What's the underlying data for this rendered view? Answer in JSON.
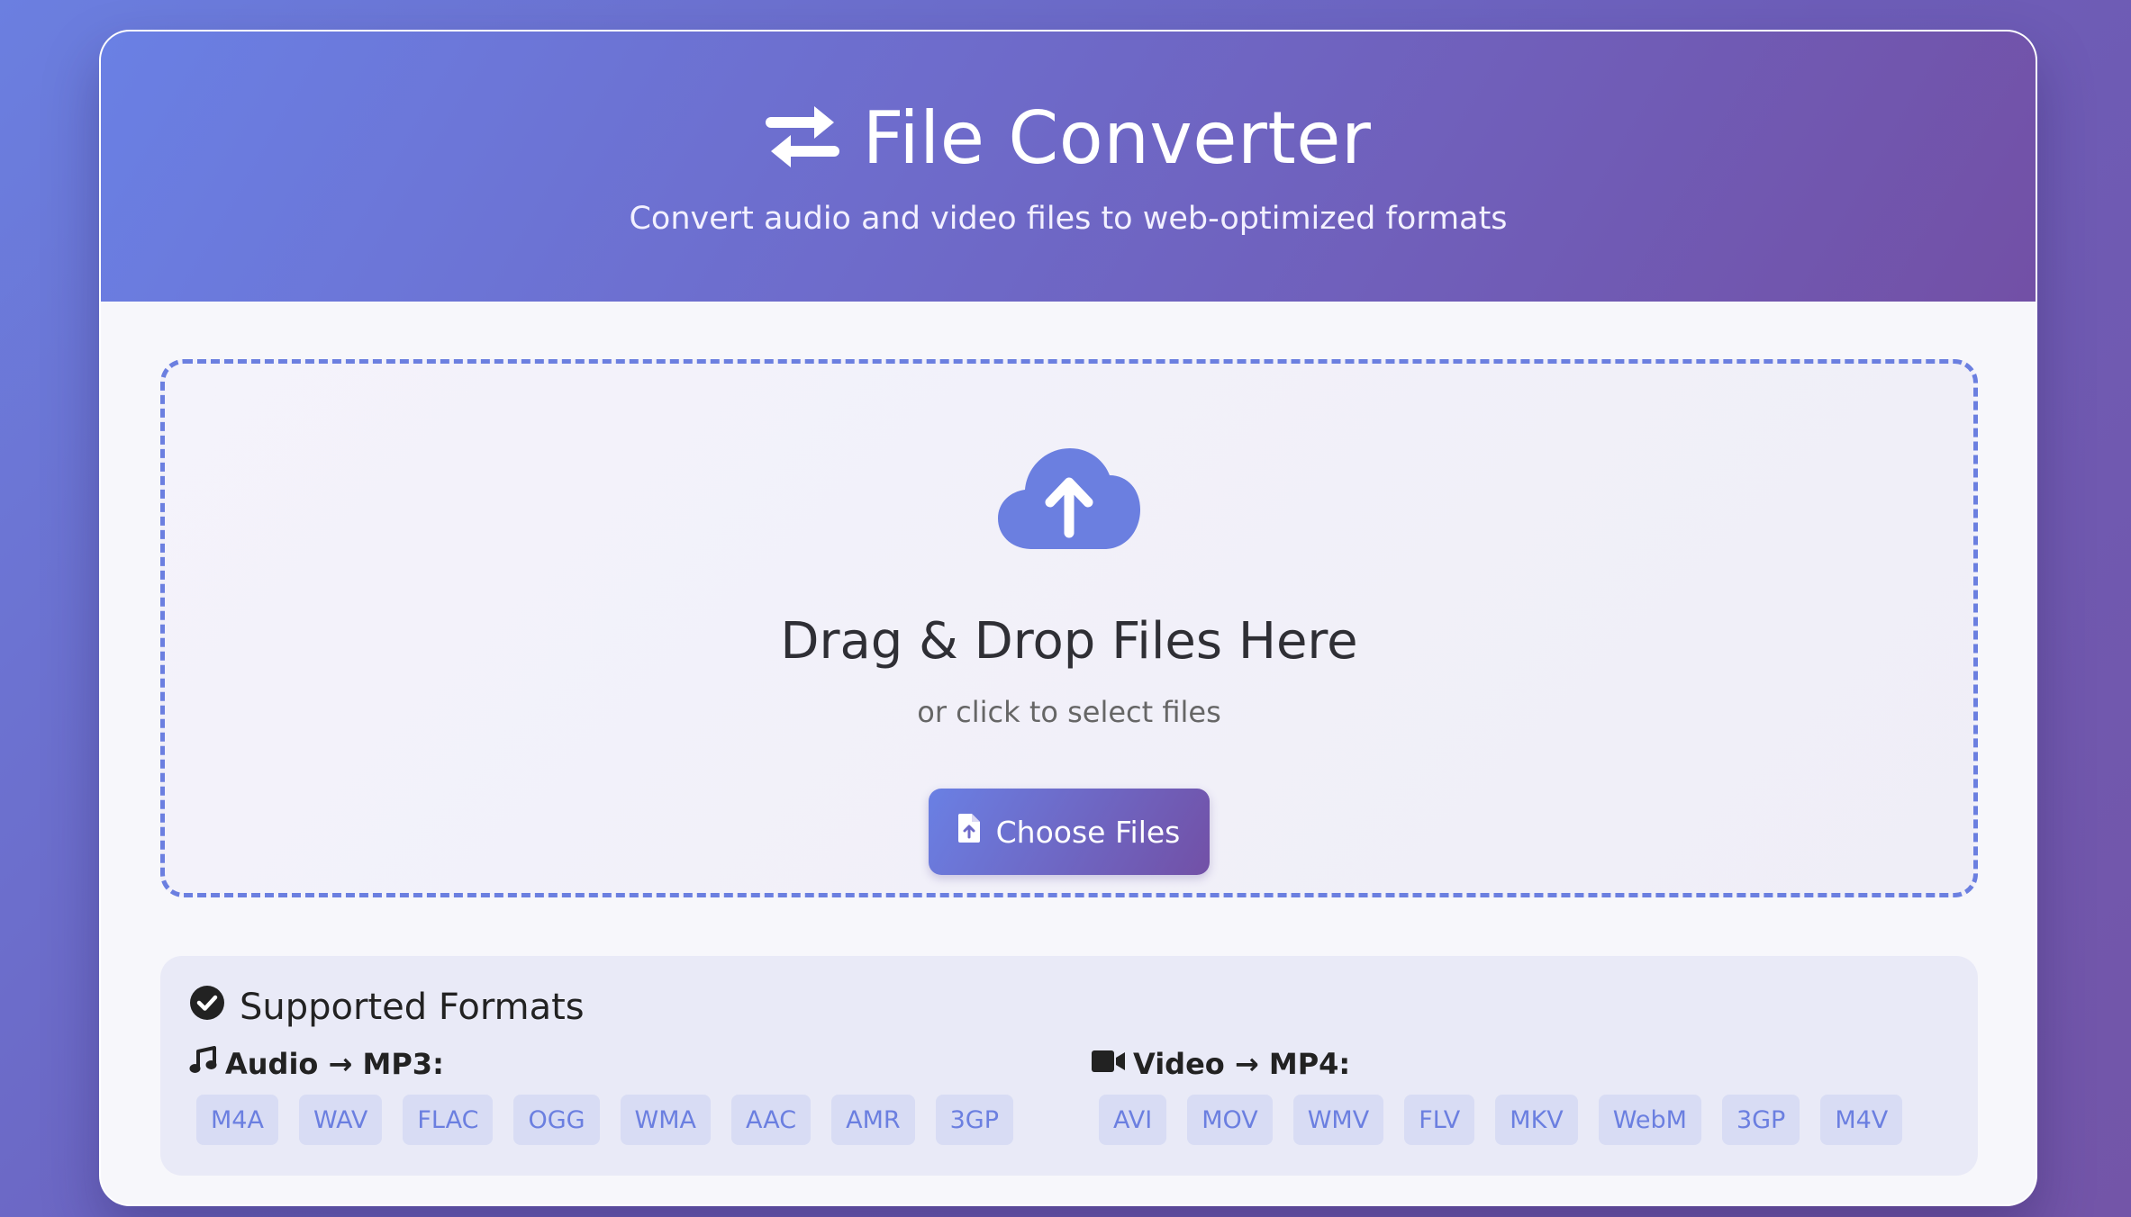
{
  "header": {
    "icon": "exchange-arrows-icon",
    "title": "File Converter",
    "subtitle": "Convert audio and video files to web-optimized formats"
  },
  "dropzone": {
    "icon": "cloud-upload-icon",
    "title": "Drag & Drop Files Here",
    "subtitle": "or click to select files",
    "button_label": "Choose Files",
    "button_icon": "file-upload-icon"
  },
  "formats": {
    "icon": "check-circle-icon",
    "title": "Supported Formats",
    "audio": {
      "icon": "music-note-icon",
      "label": "Audio → MP3:",
      "tags": [
        "M4A",
        "WAV",
        "FLAC",
        "OGG",
        "WMA",
        "AAC",
        "AMR",
        "3GP"
      ]
    },
    "video": {
      "icon": "video-camera-icon",
      "label": "Video → MP4:",
      "tags": [
        "AVI",
        "MOV",
        "WMV",
        "FLV",
        "MKV",
        "WebM",
        "3GP",
        "M4V"
      ]
    }
  },
  "colors": {
    "accent": "#6b7fe0",
    "accent_dark": "#7250a6",
    "tag_bg": "#d8dcf4"
  }
}
